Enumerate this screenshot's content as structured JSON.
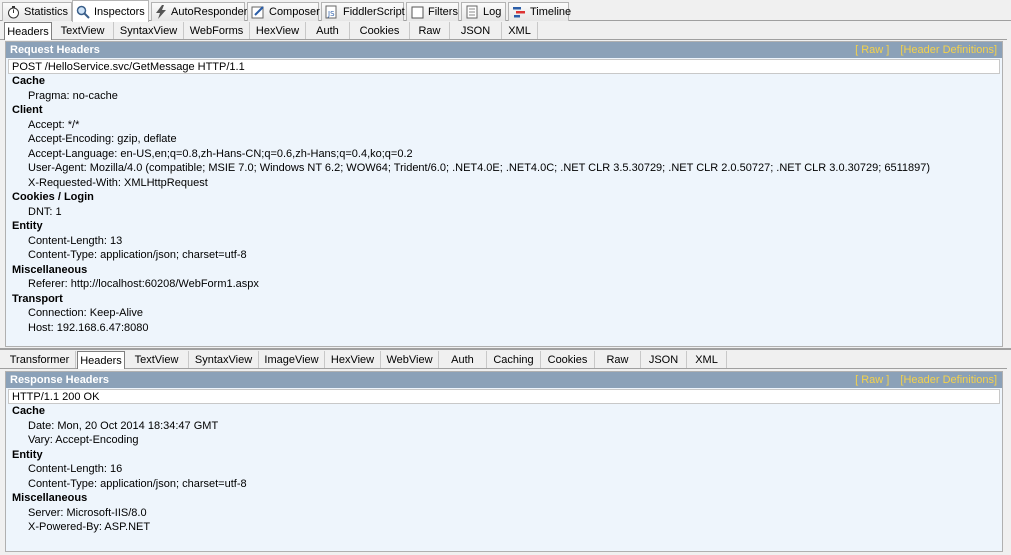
{
  "main_tabs": [
    {
      "label": "Statistics",
      "icon": "stopwatch-icon"
    },
    {
      "label": "Inspectors",
      "icon": "magnifier-icon"
    },
    {
      "label": "AutoResponder",
      "icon": "lightning-icon"
    },
    {
      "label": "Composer",
      "icon": "pencil-icon"
    },
    {
      "label": "FiddlerScript",
      "icon": "script-icon"
    },
    {
      "label": "Filters",
      "icon": "checkbox-icon"
    },
    {
      "label": "Log",
      "icon": "document-icon"
    },
    {
      "label": "Timeline",
      "icon": "timeline-icon"
    }
  ],
  "request_tabs": [
    "Headers",
    "TextView",
    "SyntaxView",
    "WebForms",
    "HexView",
    "Auth",
    "Cookies",
    "Raw",
    "JSON",
    "XML"
  ],
  "request": {
    "title": "Request Headers",
    "raw_link": "[ Raw ]",
    "defs_link": "[Header Definitions]",
    "request_line": "POST /HelloService.svc/GetMessage HTTP/1.1",
    "groups": [
      {
        "name": "Cache",
        "items": [
          "Pragma: no-cache"
        ]
      },
      {
        "name": "Client",
        "items": [
          "Accept: */*",
          "Accept-Encoding: gzip, deflate",
          "Accept-Language: en-US,en;q=0.8,zh-Hans-CN;q=0.6,zh-Hans;q=0.4,ko;q=0.2",
          "User-Agent: Mozilla/4.0 (compatible; MSIE 7.0; Windows NT 6.2; WOW64; Trident/6.0; .NET4.0E; .NET4.0C; .NET CLR 3.5.30729; .NET CLR 2.0.50727; .NET CLR 3.0.30729; 6511897)",
          "X-Requested-With: XMLHttpRequest"
        ]
      },
      {
        "name": "Cookies / Login",
        "items": [
          "DNT: 1"
        ]
      },
      {
        "name": "Entity",
        "items": [
          "Content-Length: 13",
          "Content-Type: application/json; charset=utf-8"
        ]
      },
      {
        "name": "Miscellaneous",
        "items": [
          "Referer: http://localhost:60208/WebForm1.aspx"
        ]
      },
      {
        "name": "Transport",
        "items": [
          "Connection: Keep-Alive",
          "Host: 192.168.6.47:8080"
        ]
      }
    ]
  },
  "response_tabs": [
    "Transformer",
    "Headers",
    "TextView",
    "SyntaxView",
    "ImageView",
    "HexView",
    "WebView",
    "Auth",
    "Caching",
    "Cookies",
    "Raw",
    "JSON",
    "XML"
  ],
  "response": {
    "title": "Response Headers",
    "raw_link": "[ Raw ]",
    "defs_link": "[Header Definitions]",
    "status_line": "HTTP/1.1 200 OK",
    "groups": [
      {
        "name": "Cache",
        "items": [
          "Date: Mon, 20 Oct 2014 18:34:47 GMT",
          "Vary: Accept-Encoding"
        ]
      },
      {
        "name": "Entity",
        "items": [
          "Content-Length: 16",
          "Content-Type: application/json; charset=utf-8"
        ]
      },
      {
        "name": "Miscellaneous",
        "items": [
          "Server: Microsoft-IIS/8.0",
          "X-Powered-By: ASP.NET"
        ]
      }
    ]
  },
  "colors": {
    "header_bar": "#8ba1b8",
    "link": "#f5d24a",
    "panel_bg": "#eef5fc"
  }
}
